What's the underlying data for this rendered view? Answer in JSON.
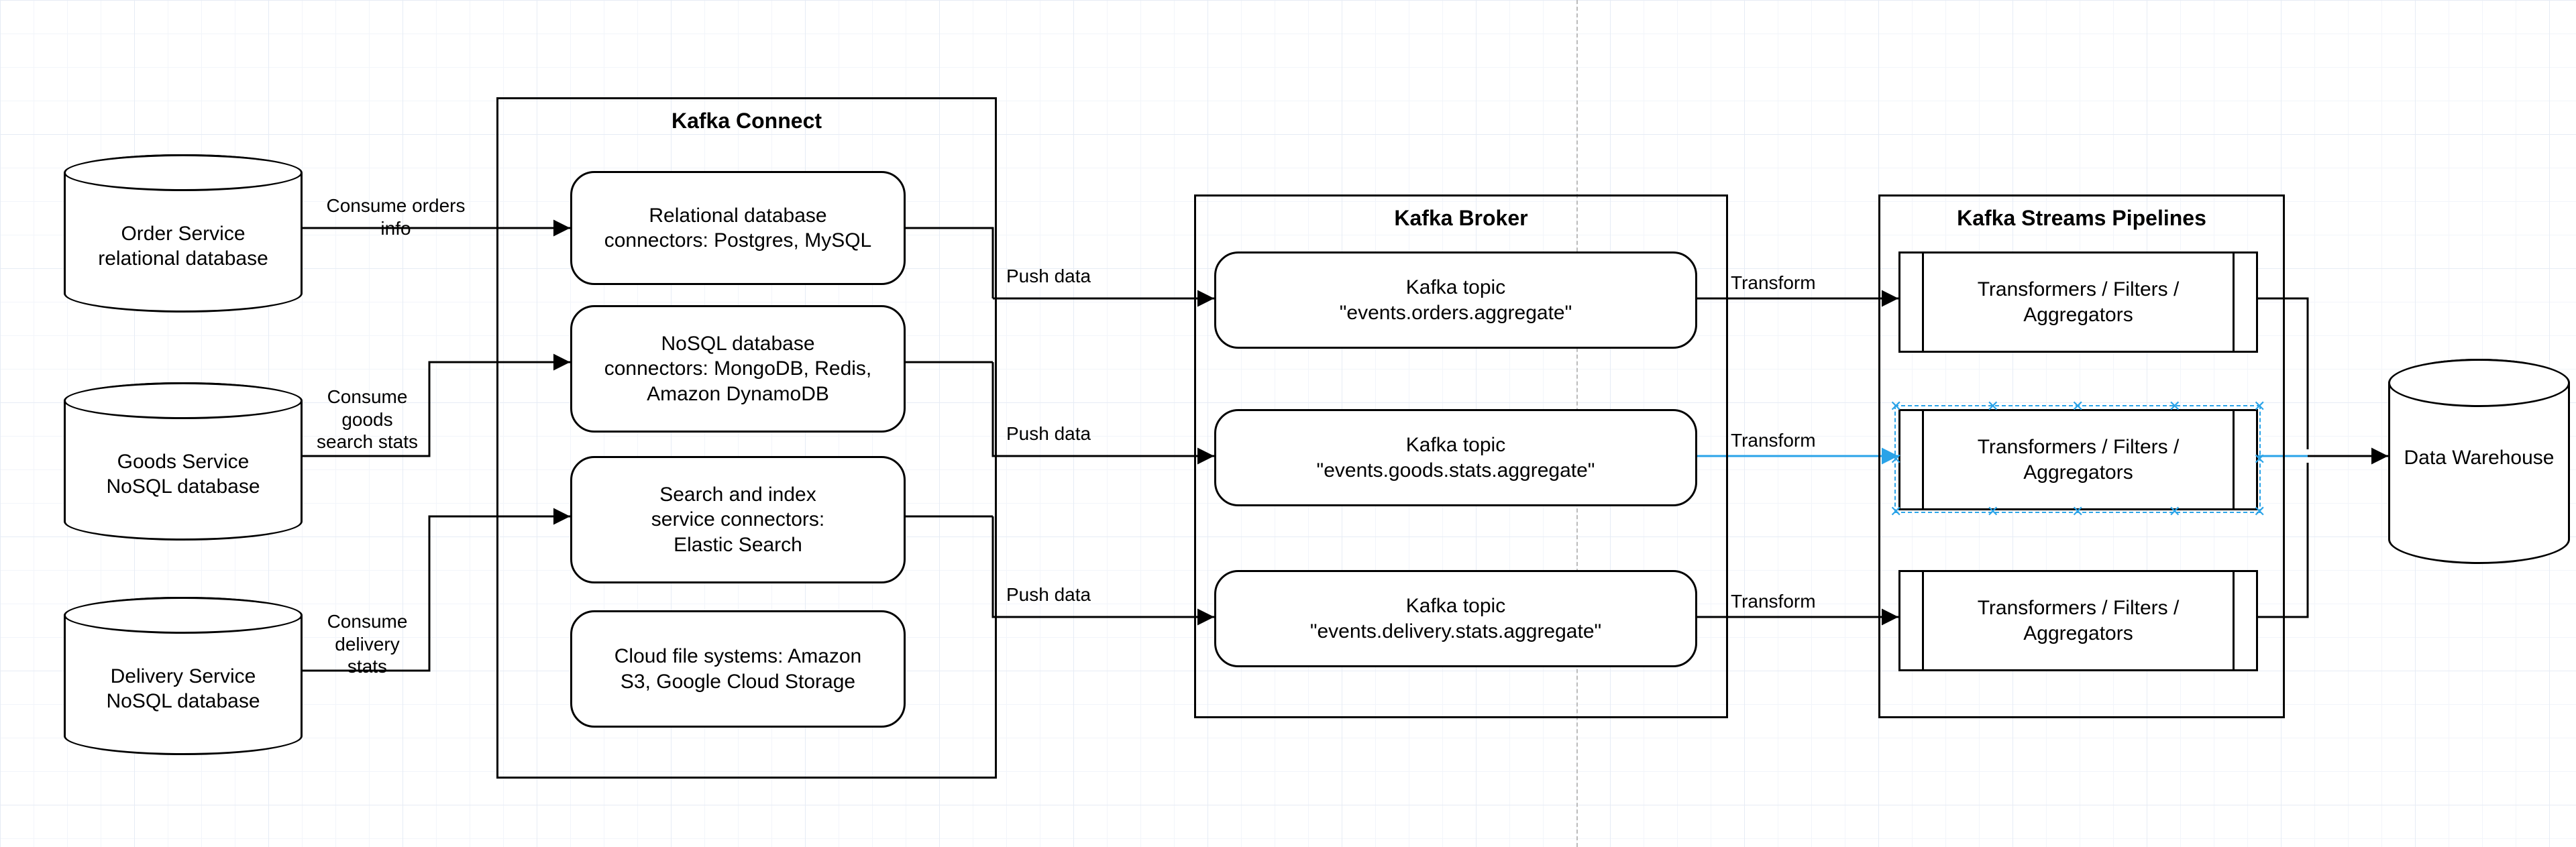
{
  "databases": {
    "order": {
      "label": "Order Service\nrelational database"
    },
    "goods": {
      "label": "Goods Service\nNoSQL database"
    },
    "delivery": {
      "label": "Delivery Service\nNoSQL database"
    },
    "warehouse": {
      "label": "Data Warehouse"
    }
  },
  "frames": {
    "connect": {
      "title": "Kafka Connect"
    },
    "broker": {
      "title": "Kafka Broker"
    },
    "streams": {
      "title": "Kafka Streams Pipelines"
    }
  },
  "connect_boxes": {
    "relational": "Relational database\nconnectors: Postgres, MySQL",
    "nosql": "NoSQL database\nconnectors: MongoDB, Redis,\nAmazon DynamoDB",
    "search": "Search and index\nservice connectors:\nElastic Search",
    "cloud": "Cloud file systems: Amazon\nS3, Google Cloud Storage"
  },
  "broker_boxes": {
    "orders": "Kafka topic\n\"events.orders.aggregate\"",
    "goods": "Kafka topic\n\"events.goods.stats.aggregate\"",
    "delivery": "Kafka topic\n\"events.delivery.stats.aggregate\""
  },
  "streams_boxes": {
    "p1": "Transformers / Filters /\nAggregators",
    "p2": "Transformers / Filters /\nAggregators",
    "p3": "Transformers / Filters /\nAggregators"
  },
  "edge_labels": {
    "consume_orders": "Consume orders\ninfo",
    "consume_goods": "Consume\ngoods\nsearch stats",
    "consume_delivery": "Consume\ndelivery\nstats",
    "push1": "Push data",
    "push2": "Push data",
    "push3": "Push data",
    "t1": "Transform",
    "t2": "Transform",
    "t3": "Transform"
  }
}
